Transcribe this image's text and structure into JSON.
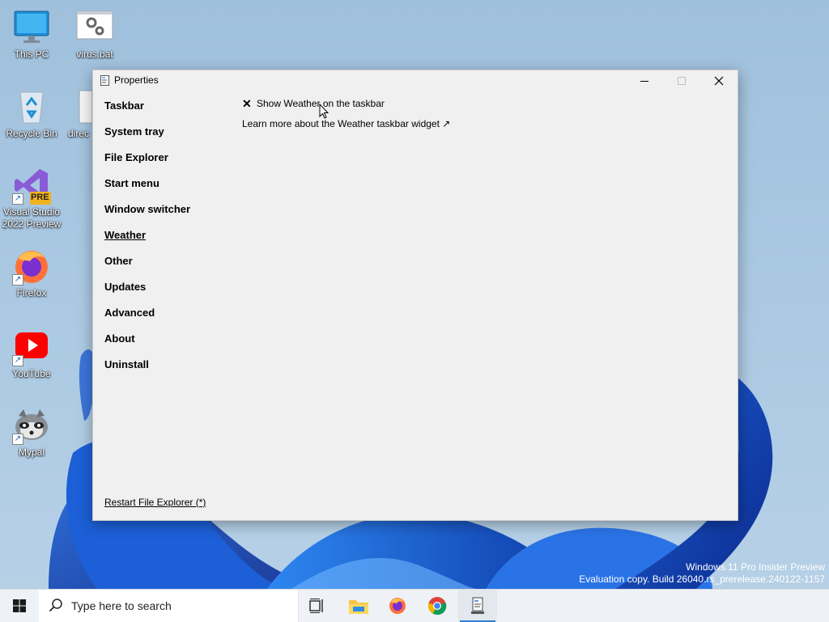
{
  "desktop": {
    "icons": [
      {
        "label": "This PC"
      },
      {
        "label": "virus.bat"
      },
      {
        "label": "Recycle Bin"
      },
      {
        "label": "direc"
      },
      {
        "label": "Visual Studio 2022 Preview",
        "badge": "PRE"
      },
      {
        "label": "Firefox"
      },
      {
        "label": "YouTube"
      },
      {
        "label": "Mypal"
      }
    ]
  },
  "window": {
    "title": "Properties",
    "nav": [
      "Taskbar",
      "System tray",
      "File Explorer",
      "Start menu",
      "Window switcher",
      "Weather",
      "Other",
      "Updates",
      "Advanced",
      "About",
      "Uninstall"
    ],
    "active_nav": "Weather",
    "option": {
      "mark": "✕",
      "label": "Show Weather on the taskbar"
    },
    "learn_more": "Learn more about the Weather taskbar widget ↗",
    "restart": "Restart File Explorer (*)"
  },
  "watermark": {
    "line1": "Windows 11 Pro Insider Preview",
    "line2": "Evaluation copy. Build 26040.rs_prerelease.240122-1157"
  },
  "taskbar": {
    "search_placeholder": "Type here to search",
    "pinned": [
      "task-view-icon",
      "file-explorer-icon",
      "firefox-icon",
      "chrome-icon",
      "properties-app-icon"
    ]
  }
}
